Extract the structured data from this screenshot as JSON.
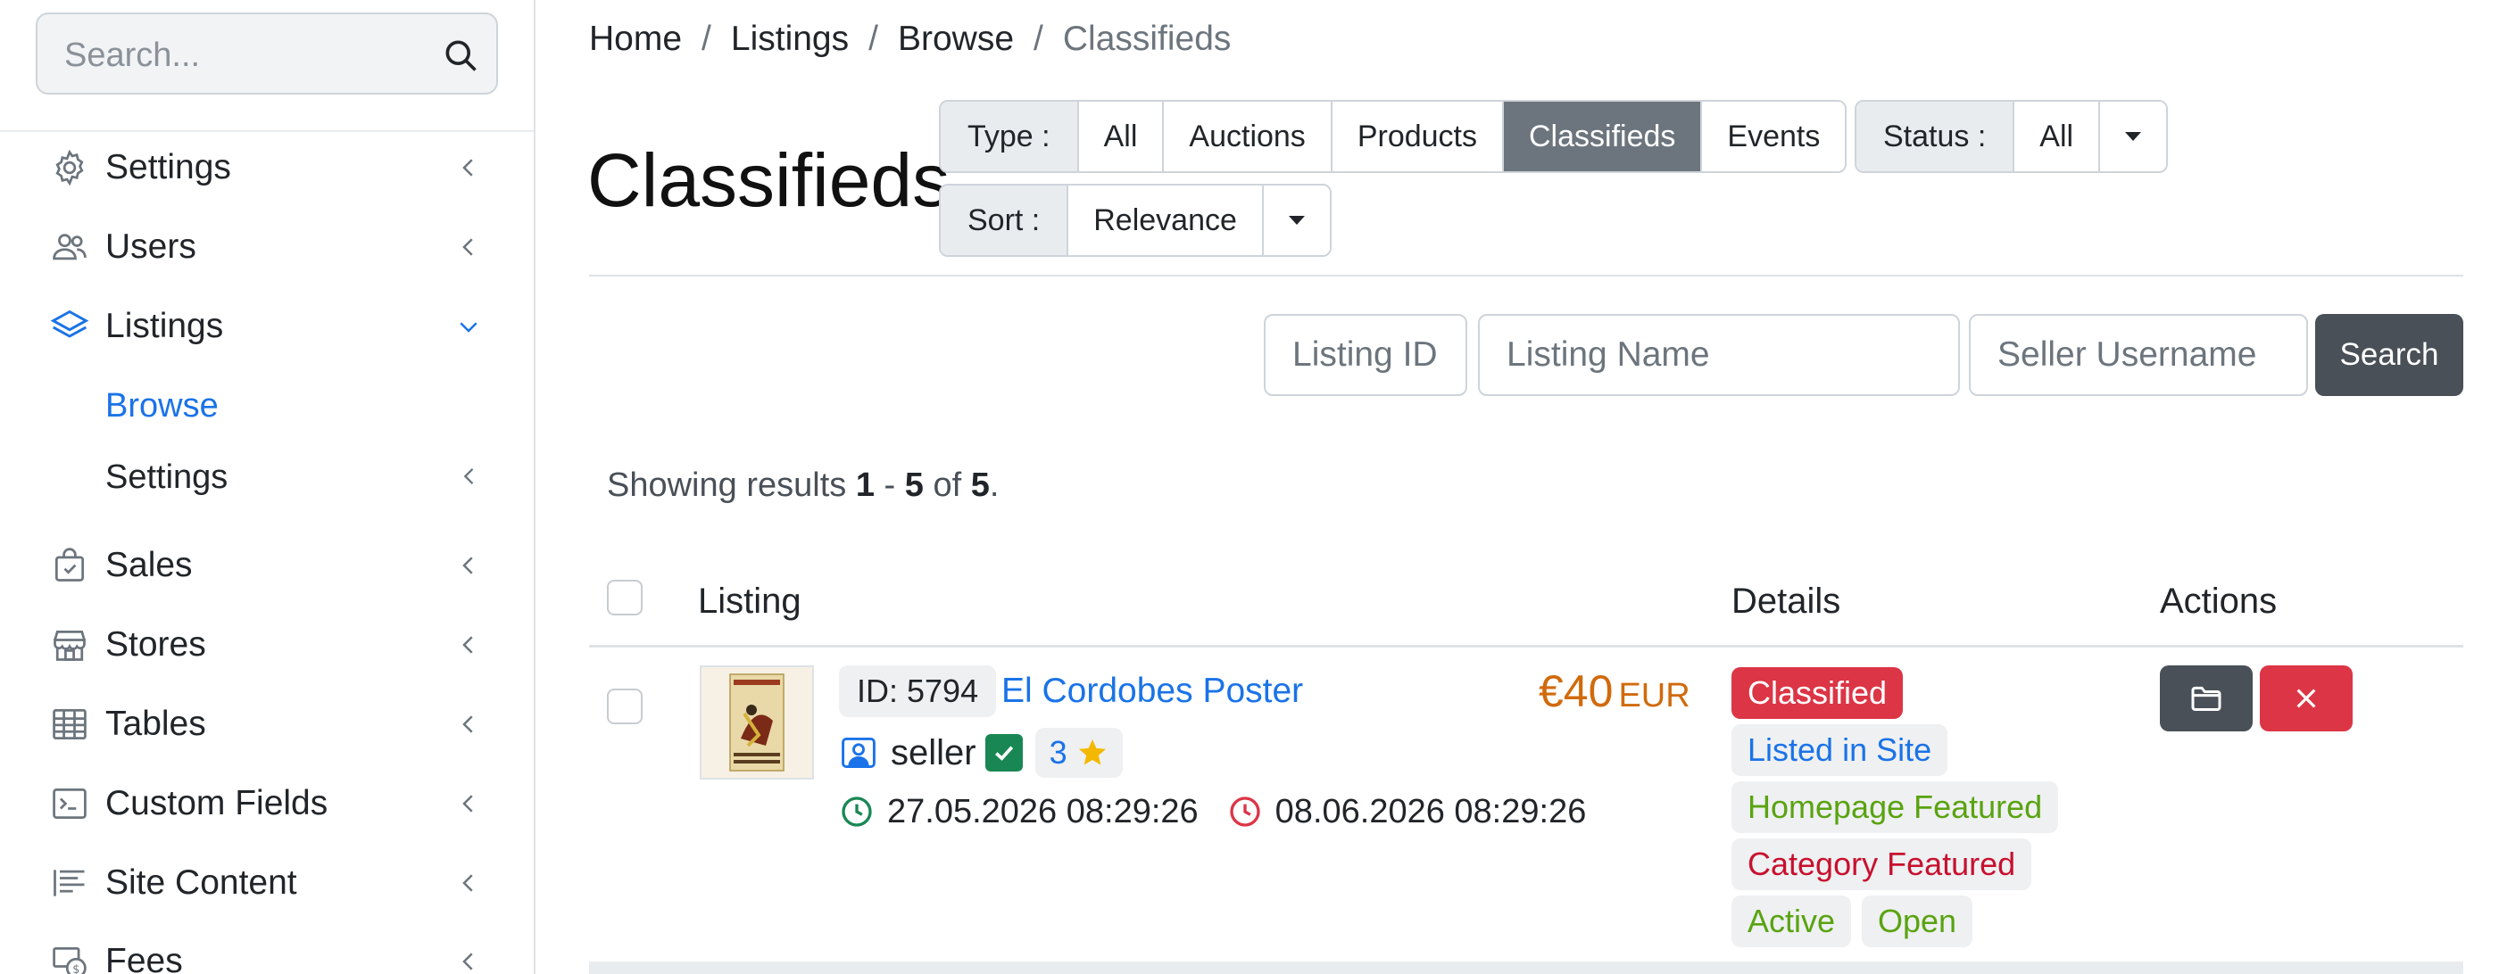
{
  "sidebar": {
    "search_placeholder": "Search...",
    "items": [
      {
        "label": "Settings",
        "icon": "gear-icon"
      },
      {
        "label": "Users",
        "icon": "users-icon"
      },
      {
        "label": "Listings",
        "icon": "layers-icon",
        "expanded": true
      },
      {
        "label": "Sales",
        "icon": "shopping-bag-icon"
      },
      {
        "label": "Stores",
        "icon": "store-icon"
      },
      {
        "label": "Tables",
        "icon": "table-icon"
      },
      {
        "label": "Custom Fields",
        "icon": "terminal-icon"
      },
      {
        "label": "Site Content",
        "icon": "text-lines-icon"
      },
      {
        "label": "Fees",
        "icon": "fees-icon"
      }
    ],
    "sub_items": [
      {
        "label": "Browse",
        "active": true
      },
      {
        "label": "Settings"
      }
    ]
  },
  "breadcrumb": [
    "Home",
    "Listings",
    "Browse",
    "Classifieds"
  ],
  "breadcrumb_sep": "/",
  "page_title": "Classifieds",
  "filters": {
    "type_label": "Type :",
    "type_options": [
      "All",
      "Auctions",
      "Products",
      "Classifieds",
      "Events"
    ],
    "type_selected": "Classifieds",
    "status_label": "Status :",
    "status_value": "All",
    "sort_label": "Sort :",
    "sort_value": "Relevance"
  },
  "search_form": {
    "listing_id_placeholder": "Listing ID",
    "listing_name_placeholder": "Listing Name",
    "seller_placeholder": "Seller Username",
    "search_label": "Search"
  },
  "results": {
    "prefix": "Showing results",
    "from": "1",
    "dash": "-",
    "to": "5",
    "of": "of",
    "total": "5",
    "suffix": "."
  },
  "table": {
    "headers": {
      "listing": "Listing",
      "details": "Details",
      "actions": "Actions"
    },
    "rows": [
      {
        "id_label": "ID: 5794",
        "title": "El Cordobes Poster",
        "price_amount": "€40",
        "price_currency": "EUR",
        "seller": "seller",
        "rating": "3",
        "start_date": "27.05.2026 08:29:26",
        "end_date": "08.06.2026 08:29:26",
        "badges": [
          "Classified",
          "Listed in Site",
          "Homepage Featured",
          "Category Featured",
          "Active",
          "Open"
        ]
      }
    ]
  },
  "colors": {
    "accent_blue": "#1a73e8",
    "selected_gray": "#6c757d",
    "danger": "#dc3545",
    "price_orange": "#d16a0c",
    "success": "#198754"
  }
}
